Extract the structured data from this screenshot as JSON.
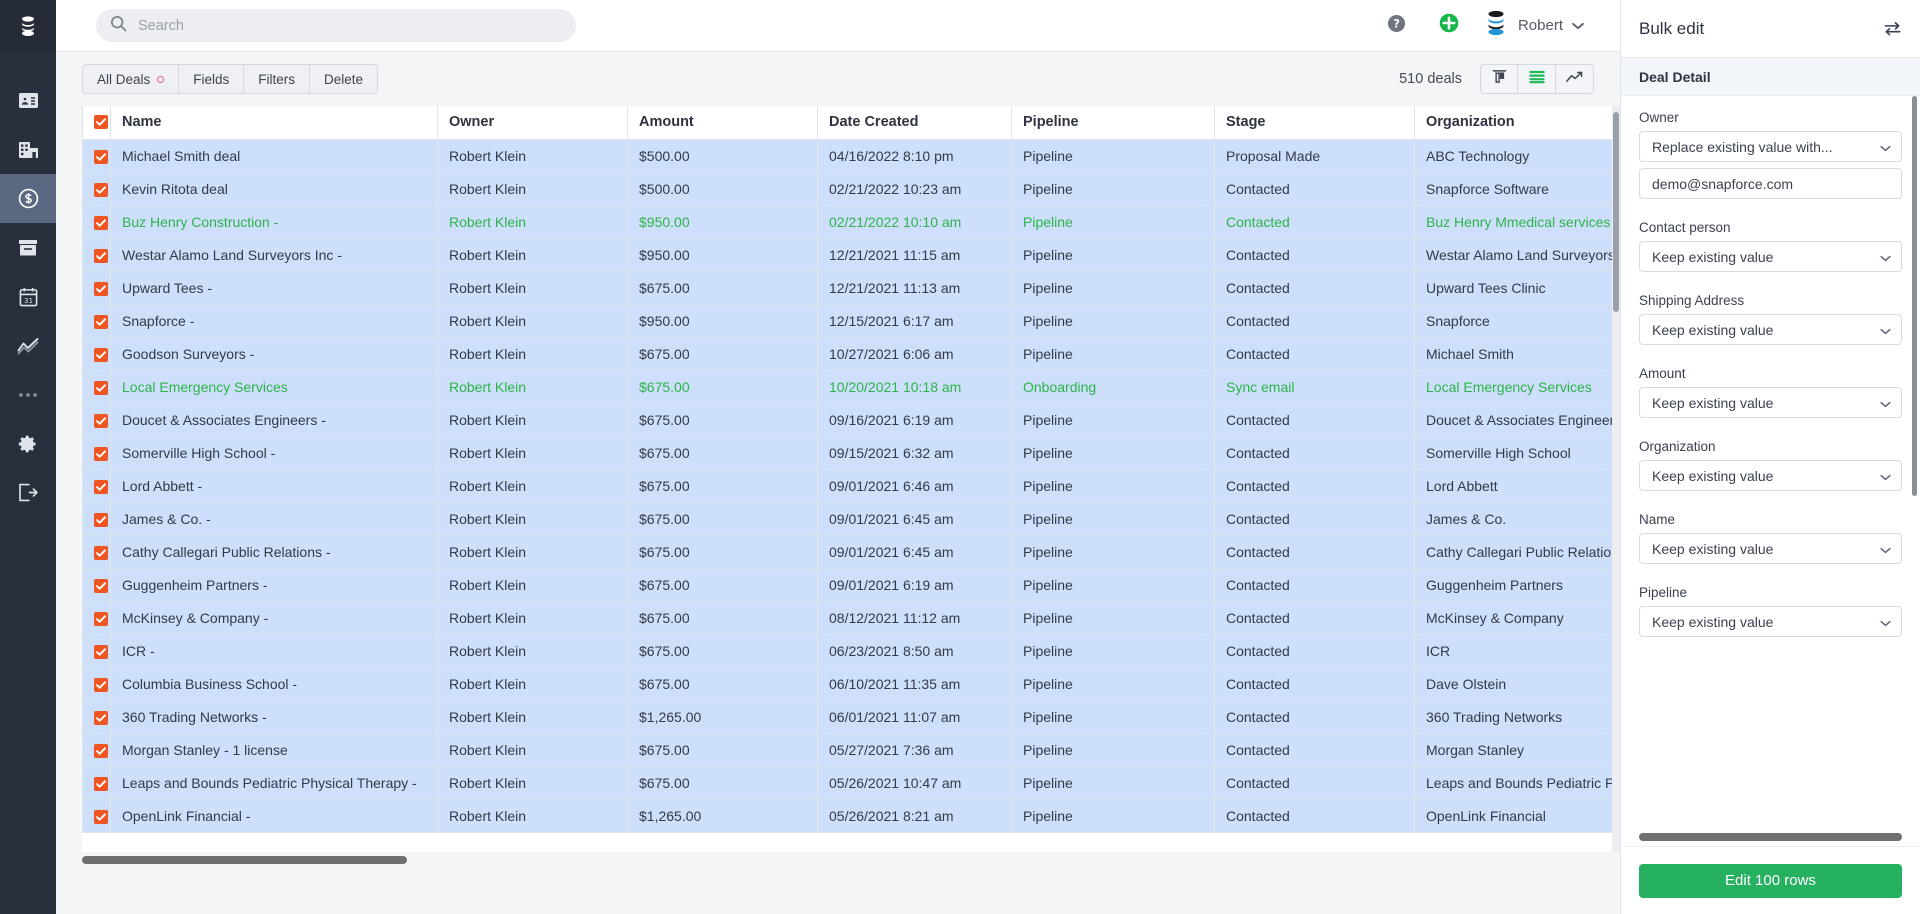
{
  "rail": {
    "logo_icon": "snapforce-logo-icon",
    "items": [
      {
        "id": "contacts",
        "icon": "contact-card-icon",
        "active": false
      },
      {
        "id": "organizations",
        "icon": "building-icon",
        "active": false
      },
      {
        "id": "deals",
        "icon": "dollar-circle-icon",
        "active": true
      },
      {
        "id": "inbox",
        "icon": "archive-box-icon",
        "active": false
      },
      {
        "id": "calendar",
        "icon": "calendar-31-icon",
        "active": false
      },
      {
        "id": "reports",
        "icon": "line-chart-icon",
        "active": false
      },
      {
        "id": "more",
        "icon": "ellipsis-icon",
        "active": false
      },
      {
        "id": "settings",
        "icon": "gear-icon",
        "active": false
      },
      {
        "id": "logout",
        "icon": "logout-icon",
        "active": false
      }
    ]
  },
  "topbar": {
    "search_placeholder": "Search",
    "search_value": "",
    "help_icon": "question-mark-circle-icon",
    "add_icon": "plus-circle-icon",
    "avatar_icon": "snapforce-avatar-icon",
    "user_name": "Robert",
    "chevron_icon": "chevron-down-icon"
  },
  "toolbar": {
    "buttons": [
      {
        "label": "All Deals",
        "badge": "pink-dot"
      },
      {
        "label": "Fields",
        "badge": null
      },
      {
        "label": "Filters",
        "badge": null
      },
      {
        "label": "Delete",
        "badge": null
      }
    ],
    "deal_count": "510 deals",
    "views": [
      {
        "id": "kanban",
        "icon": "column-view-icon",
        "active": false
      },
      {
        "id": "list",
        "icon": "list-view-icon",
        "active": true
      },
      {
        "id": "chart",
        "icon": "trend-chart-icon",
        "active": false
      }
    ]
  },
  "table": {
    "columns": [
      "Name",
      "Owner",
      "Amount",
      "Date Created",
      "Pipeline",
      "Stage",
      "Organization"
    ],
    "header_checkbox_checked": true,
    "rows": [
      {
        "checked": true,
        "highlight": false,
        "name": "Michael Smith deal",
        "owner": "Robert Klein",
        "amount": "$500.00",
        "date": "04/16/2022 8:10 pm",
        "pipeline": "Pipeline",
        "stage": "Proposal Made",
        "organization": "ABC Technology"
      },
      {
        "checked": true,
        "highlight": false,
        "name": "Kevin Ritota deal",
        "owner": "Robert Klein",
        "amount": "$500.00",
        "date": "02/21/2022 10:23 am",
        "pipeline": "Pipeline",
        "stage": "Contacted",
        "organization": "Snapforce Software"
      },
      {
        "checked": true,
        "highlight": true,
        "name": "Buz Henry Construction -",
        "owner": "Robert Klein",
        "amount": "$950.00",
        "date": "02/21/2022 10:10 am",
        "pipeline": "Pipeline",
        "stage": "Contacted",
        "organization": "Buz Henry Mmedical services"
      },
      {
        "checked": true,
        "highlight": false,
        "name": "Westar Alamo Land Surveyors Inc -",
        "owner": "Robert Klein",
        "amount": "$950.00",
        "date": "12/21/2021 11:15 am",
        "pipeline": "Pipeline",
        "stage": "Contacted",
        "organization": "Westar Alamo Land Surveyors Inc"
      },
      {
        "checked": true,
        "highlight": false,
        "name": "Upward Tees -",
        "owner": "Robert Klein",
        "amount": "$675.00",
        "date": "12/21/2021 11:13 am",
        "pipeline": "Pipeline",
        "stage": "Contacted",
        "organization": "Upward Tees Clinic"
      },
      {
        "checked": true,
        "highlight": false,
        "name": "Snapforce -",
        "owner": "Robert Klein",
        "amount": "$950.00",
        "date": "12/15/2021 6:17 am",
        "pipeline": "Pipeline",
        "stage": "Contacted",
        "organization": "Snapforce"
      },
      {
        "checked": true,
        "highlight": false,
        "name": "Goodson Surveyors -",
        "owner": "Robert Klein",
        "amount": "$675.00",
        "date": "10/27/2021 6:06 am",
        "pipeline": "Pipeline",
        "stage": "Contacted",
        "organization": "Michael Smith"
      },
      {
        "checked": true,
        "highlight": true,
        "name": "Local Emergency Services",
        "owner": "Robert Klein",
        "amount": "$675.00",
        "date": "10/20/2021 10:18 am",
        "pipeline": "Onboarding",
        "stage": "Sync email",
        "organization": "Local Emergency Services"
      },
      {
        "checked": true,
        "highlight": false,
        "name": "Doucet & Associates Engineers -",
        "owner": "Robert Klein",
        "amount": "$675.00",
        "date": "09/16/2021 6:19 am",
        "pipeline": "Pipeline",
        "stage": "Contacted",
        "organization": "Doucet & Associates Engineers"
      },
      {
        "checked": true,
        "highlight": false,
        "name": "Somerville High School -",
        "owner": "Robert Klein",
        "amount": "$675.00",
        "date": "09/15/2021 6:32 am",
        "pipeline": "Pipeline",
        "stage": "Contacted",
        "organization": "Somerville High School"
      },
      {
        "checked": true,
        "highlight": false,
        "name": "Lord Abbett -",
        "owner": "Robert Klein",
        "amount": "$675.00",
        "date": "09/01/2021 6:46 am",
        "pipeline": "Pipeline",
        "stage": "Contacted",
        "organization": "Lord Abbett"
      },
      {
        "checked": true,
        "highlight": false,
        "name": "James & Co. -",
        "owner": "Robert Klein",
        "amount": "$675.00",
        "date": "09/01/2021 6:45 am",
        "pipeline": "Pipeline",
        "stage": "Contacted",
        "organization": "James & Co."
      },
      {
        "checked": true,
        "highlight": false,
        "name": "Cathy Callegari Public Relations -",
        "owner": "Robert Klein",
        "amount": "$675.00",
        "date": "09/01/2021 6:45 am",
        "pipeline": "Pipeline",
        "stage": "Contacted",
        "organization": "Cathy Callegari Public Relations"
      },
      {
        "checked": true,
        "highlight": false,
        "name": "Guggenheim Partners -",
        "owner": "Robert Klein",
        "amount": "$675.00",
        "date": "09/01/2021 6:19 am",
        "pipeline": "Pipeline",
        "stage": "Contacted",
        "organization": "Guggenheim Partners"
      },
      {
        "checked": true,
        "highlight": false,
        "name": "McKinsey & Company -",
        "owner": "Robert Klein",
        "amount": "$675.00",
        "date": "08/12/2021 11:12 am",
        "pipeline": "Pipeline",
        "stage": "Contacted",
        "organization": "McKinsey & Company"
      },
      {
        "checked": true,
        "highlight": false,
        "name": "ICR -",
        "owner": "Robert Klein",
        "amount": "$675.00",
        "date": "06/23/2021 8:50 am",
        "pipeline": "Pipeline",
        "stage": "Contacted",
        "organization": "ICR"
      },
      {
        "checked": true,
        "highlight": false,
        "name": "Columbia Business School -",
        "owner": "Robert Klein",
        "amount": "$675.00",
        "date": "06/10/2021 11:35 am",
        "pipeline": "Pipeline",
        "stage": "Contacted",
        "organization": "Dave Olstein"
      },
      {
        "checked": true,
        "highlight": false,
        "name": "360 Trading Networks -",
        "owner": "Robert Klein",
        "amount": "$1,265.00",
        "date": "06/01/2021 11:07 am",
        "pipeline": "Pipeline",
        "stage": "Contacted",
        "organization": "360 Trading Networks"
      },
      {
        "checked": true,
        "highlight": false,
        "name": "Morgan Stanley - 1 license",
        "owner": "Robert Klein",
        "amount": "$675.00",
        "date": "05/27/2021 7:36 am",
        "pipeline": "Pipeline",
        "stage": "Contacted",
        "organization": "Morgan Stanley"
      },
      {
        "checked": true,
        "highlight": false,
        "name": "Leaps and Bounds Pediatric Physical Therapy -",
        "owner": "Robert Klein",
        "amount": "$675.00",
        "date": "05/26/2021 10:47 am",
        "pipeline": "Pipeline",
        "stage": "Contacted",
        "organization": "Leaps and Bounds Pediatric Physical Therapy"
      },
      {
        "checked": true,
        "highlight": false,
        "name": "OpenLink Financial -",
        "owner": "Robert Klein",
        "amount": "$1,265.00",
        "date": "05/26/2021 8:21 am",
        "pipeline": "Pipeline",
        "stage": "Contacted",
        "organization": "OpenLink Financial"
      }
    ]
  },
  "panel": {
    "title": "Bulk edit",
    "swap_icon": "swap-arrows-icon",
    "section_title": "Deal Detail",
    "fields": [
      {
        "label": "Owner",
        "value": "Replace existing value with...",
        "extra_input": "demo@snapforce.com"
      },
      {
        "label": "Contact person",
        "value": "Keep existing value",
        "extra_input": null
      },
      {
        "label": "Shipping Address",
        "value": "Keep existing value",
        "extra_input": null
      },
      {
        "label": "Amount",
        "value": "Keep existing value",
        "extra_input": null
      },
      {
        "label": "Organization",
        "value": "Keep existing value",
        "extra_input": null
      },
      {
        "label": "Name",
        "value": "Keep existing value",
        "extra_input": null
      },
      {
        "label": "Pipeline",
        "value": "Keep existing value",
        "extra_input": null
      }
    ],
    "submit_label": "Edit 100 rows"
  },
  "colors": {
    "rail_bg": "#29303d",
    "rail_active": "#5b6881",
    "row_selected": "#cddffa",
    "row_highlight_text": "#2db34a",
    "checkbox": "#ef5522",
    "primary_green": "#26b161",
    "badge_pink": "#f0608c"
  }
}
